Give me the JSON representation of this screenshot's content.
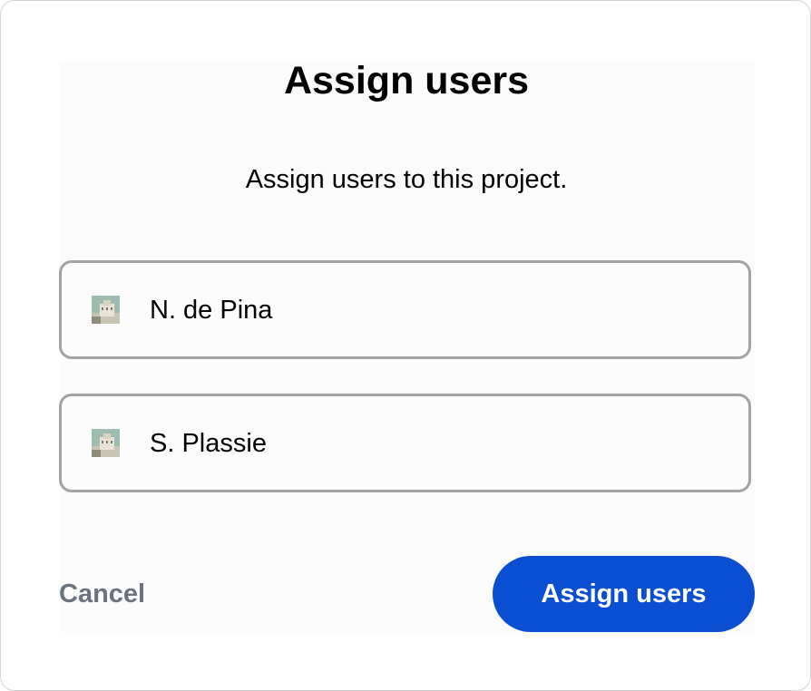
{
  "dialog": {
    "title": "Assign users",
    "subtitle": "Assign users to this project."
  },
  "users": [
    {
      "name": "N. de Pina",
      "avatar_icon": "user-avatar-photo"
    },
    {
      "name": "S. Plassie",
      "avatar_icon": "user-avatar-photo"
    }
  ],
  "actions": {
    "cancel_label": "Cancel",
    "assign_label": "Assign users"
  },
  "colors": {
    "primary_button": "#0a4fd1",
    "cancel_text": "#6b7280",
    "card_border": "#a3a3a3"
  }
}
